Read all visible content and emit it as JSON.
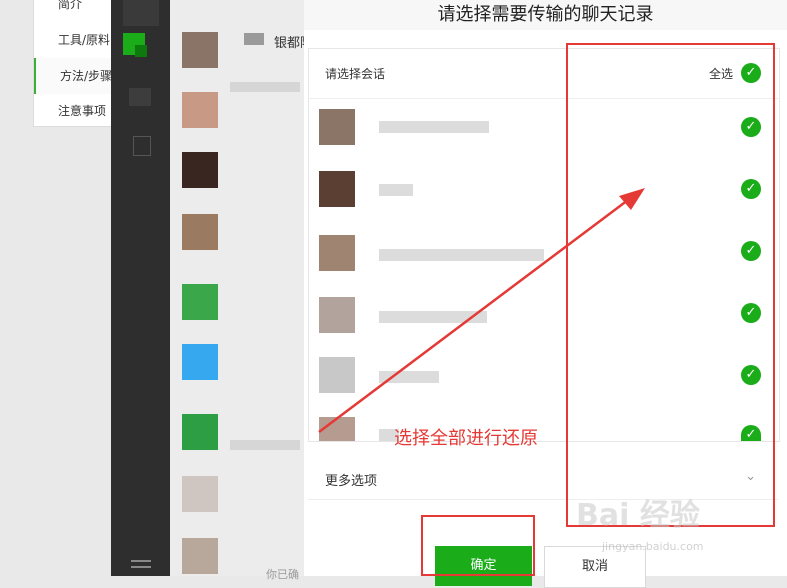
{
  "left_nav": {
    "items": [
      {
        "label": "简介"
      },
      {
        "label": "工具/原料"
      },
      {
        "label": "方法/步骤"
      },
      {
        "label": "注意事项"
      }
    ]
  },
  "chat_list": {
    "first_name_fragment": "银都阿",
    "bottom_fragment": "你已确"
  },
  "dialog": {
    "title": "请选择需要传输的聊天记录",
    "list_header": "请选择会话",
    "select_all": "全选",
    "more_options": "更多选项",
    "confirm": "确定",
    "cancel": "取消"
  },
  "annotation": {
    "text": "选择全部进行还原"
  },
  "watermark": {
    "text": "Bai 经验",
    "sub": "jingyan.baidu.com"
  },
  "colors": {
    "accent_green": "#1aad19",
    "annotation_red": "#e53935",
    "sidebar_dark": "#2e2e2e"
  }
}
